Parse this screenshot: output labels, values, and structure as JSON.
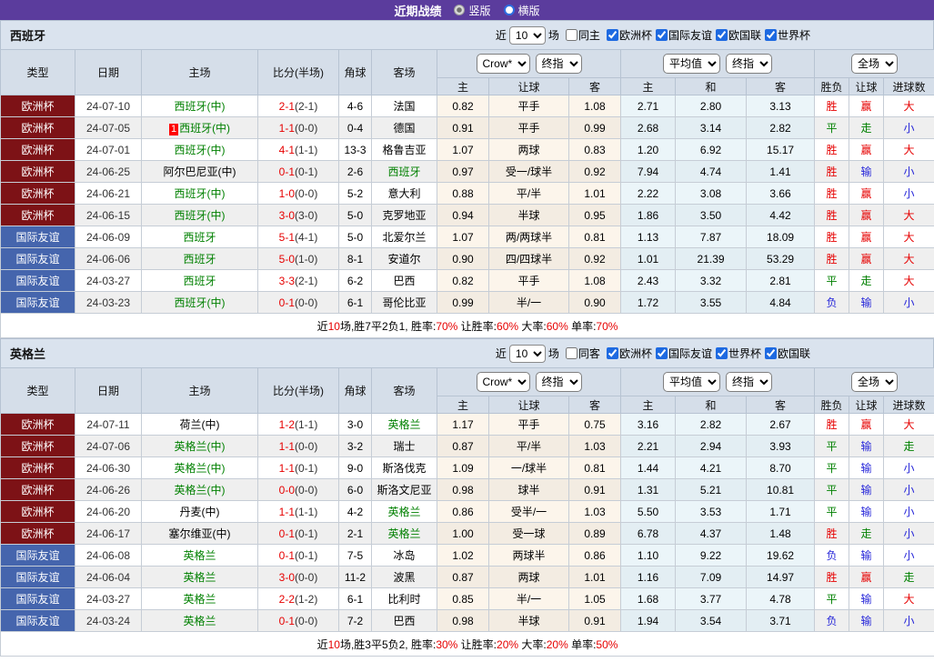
{
  "topbar": {
    "title": "近期战绩",
    "vertical_option": "竖版",
    "horizontal_option": "横版",
    "selected": "竖版"
  },
  "columns": {
    "main": [
      "类型",
      "日期",
      "主场",
      "比分(半场)",
      "角球",
      "客场"
    ],
    "sub": [
      "主",
      "让球",
      "客",
      "主",
      "和",
      "客",
      "胜负",
      "让球",
      "进球数"
    ],
    "selects": {
      "crow": "Crow*",
      "final1": "终指",
      "avg": "平均值",
      "final2": "终指",
      "scope": "全场"
    }
  },
  "result_color_class": {
    "胜": "red",
    "平": "green",
    "负": "blue",
    "赢": "red",
    "走": "green",
    "输": "blue",
    "大": "red",
    "小": "blue"
  },
  "colors": {
    "topbar": "#5b3c9d",
    "cup_league_bg": "#7d1216",
    "friendly_league_bg": "#4565ad",
    "team_highlight": "#008000",
    "score_red": "#e60000",
    "result_red": "#e60000",
    "result_green": "#008000",
    "result_blue": "#2626d9",
    "header_bg": "#d5dee9",
    "row_alt_bg": "#efefef",
    "crow_col_bg": "#fcf5eb",
    "avg_col_bg": "#ebf5f9"
  },
  "sections": [
    {
      "team": "西班牙",
      "filters": {
        "prefix": "近",
        "count": "10",
        "suffix": "场",
        "same": {
          "label": "同主",
          "checked": false
        },
        "leagues": [
          {
            "label": "欧洲杯",
            "checked": true
          },
          {
            "label": "国际友谊",
            "checked": true
          },
          {
            "label": "欧国联",
            "checked": true
          },
          {
            "label": "世界杯",
            "checked": true
          }
        ]
      },
      "rows": [
        {
          "league": "欧洲杯",
          "league_type": "cup",
          "date": "24-07-10",
          "home": "西班牙(中)",
          "home_hl": true,
          "home_badge": "",
          "score": "2-1",
          "half": "(2-1)",
          "corner": "4-6",
          "away": "法国",
          "away_hl": false,
          "crow": [
            "0.82",
            "平手",
            "1.08"
          ],
          "avg": [
            "2.71",
            "2.80",
            "3.13"
          ],
          "results": [
            "胜",
            "赢",
            "大"
          ]
        },
        {
          "league": "欧洲杯",
          "league_type": "cup",
          "date": "24-07-05",
          "home": "西班牙(中)",
          "home_hl": true,
          "home_badge": "1",
          "score": "1-1",
          "half": "(0-0)",
          "corner": "0-4",
          "away": "德国",
          "away_hl": false,
          "crow": [
            "0.91",
            "平手",
            "0.99"
          ],
          "avg": [
            "2.68",
            "3.14",
            "2.82"
          ],
          "results": [
            "平",
            "走",
            "小"
          ]
        },
        {
          "league": "欧洲杯",
          "league_type": "cup",
          "date": "24-07-01",
          "home": "西班牙(中)",
          "home_hl": true,
          "home_badge": "",
          "score": "4-1",
          "half": "(1-1)",
          "corner": "13-3",
          "away": "格鲁吉亚",
          "away_hl": false,
          "crow": [
            "1.07",
            "两球",
            "0.83"
          ],
          "avg": [
            "1.20",
            "6.92",
            "15.17"
          ],
          "results": [
            "胜",
            "赢",
            "大"
          ]
        },
        {
          "league": "欧洲杯",
          "league_type": "cup",
          "date": "24-06-25",
          "home": "阿尔巴尼亚(中)",
          "home_hl": false,
          "home_badge": "",
          "score": "0-1",
          "half": "(0-1)",
          "corner": "2-6",
          "away": "西班牙",
          "away_hl": true,
          "crow": [
            "0.97",
            "受一/球半",
            "0.92"
          ],
          "avg": [
            "7.94",
            "4.74",
            "1.41"
          ],
          "results": [
            "胜",
            "输",
            "小"
          ]
        },
        {
          "league": "欧洲杯",
          "league_type": "cup",
          "date": "24-06-21",
          "home": "西班牙(中)",
          "home_hl": true,
          "home_badge": "",
          "score": "1-0",
          "half": "(0-0)",
          "corner": "5-2",
          "away": "意大利",
          "away_hl": false,
          "crow": [
            "0.88",
            "平/半",
            "1.01"
          ],
          "avg": [
            "2.22",
            "3.08",
            "3.66"
          ],
          "results": [
            "胜",
            "赢",
            "小"
          ]
        },
        {
          "league": "欧洲杯",
          "league_type": "cup",
          "date": "24-06-15",
          "home": "西班牙(中)",
          "home_hl": true,
          "home_badge": "",
          "score": "3-0",
          "half": "(3-0)",
          "corner": "5-0",
          "away": "克罗地亚",
          "away_hl": false,
          "crow": [
            "0.94",
            "半球",
            "0.95"
          ],
          "avg": [
            "1.86",
            "3.50",
            "4.42"
          ],
          "results": [
            "胜",
            "赢",
            "大"
          ]
        },
        {
          "league": "国际友谊",
          "league_type": "friendly",
          "date": "24-06-09",
          "home": "西班牙",
          "home_hl": true,
          "home_badge": "",
          "score": "5-1",
          "half": "(4-1)",
          "corner": "5-0",
          "away": "北爱尔兰",
          "away_hl": false,
          "crow": [
            "1.07",
            "两/两球半",
            "0.81"
          ],
          "avg": [
            "1.13",
            "7.87",
            "18.09"
          ],
          "results": [
            "胜",
            "赢",
            "大"
          ]
        },
        {
          "league": "国际友谊",
          "league_type": "friendly",
          "date": "24-06-06",
          "home": "西班牙",
          "home_hl": true,
          "home_badge": "",
          "score": "5-0",
          "half": "(1-0)",
          "corner": "8-1",
          "away": "安道尔",
          "away_hl": false,
          "crow": [
            "0.90",
            "四/四球半",
            "0.92"
          ],
          "avg": [
            "1.01",
            "21.39",
            "53.29"
          ],
          "results": [
            "胜",
            "赢",
            "大"
          ]
        },
        {
          "league": "国际友谊",
          "league_type": "friendly",
          "date": "24-03-27",
          "home": "西班牙",
          "home_hl": true,
          "home_badge": "",
          "score": "3-3",
          "half": "(2-1)",
          "corner": "6-2",
          "away": "巴西",
          "away_hl": false,
          "crow": [
            "0.82",
            "平手",
            "1.08"
          ],
          "avg": [
            "2.43",
            "3.32",
            "2.81"
          ],
          "results": [
            "平",
            "走",
            "大"
          ]
        },
        {
          "league": "国际友谊",
          "league_type": "friendly",
          "date": "24-03-23",
          "home": "西班牙(中)",
          "home_hl": true,
          "home_badge": "",
          "score": "0-1",
          "half": "(0-0)",
          "corner": "6-1",
          "away": "哥伦比亚",
          "away_hl": false,
          "crow": [
            "0.99",
            "半/一",
            "0.90"
          ],
          "avg": [
            "1.72",
            "3.55",
            "4.84"
          ],
          "results": [
            "负",
            "输",
            "小"
          ]
        }
      ],
      "summary": [
        {
          "text": "近",
          "red": false
        },
        {
          "text": "10",
          "red": true
        },
        {
          "text": "场,胜7平2负1, 胜率:",
          "red": false
        },
        {
          "text": "70%",
          "red": true
        },
        {
          "text": " 让胜率:",
          "red": false
        },
        {
          "text": "60%",
          "red": true
        },
        {
          "text": " 大率:",
          "red": false
        },
        {
          "text": "60%",
          "red": true
        },
        {
          "text": " 单率:",
          "red": false
        },
        {
          "text": "70%",
          "red": true
        }
      ]
    },
    {
      "team": "英格兰",
      "filters": {
        "prefix": "近",
        "count": "10",
        "suffix": "场",
        "same": {
          "label": "同客",
          "checked": false
        },
        "leagues": [
          {
            "label": "欧洲杯",
            "checked": true
          },
          {
            "label": "国际友谊",
            "checked": true
          },
          {
            "label": "世界杯",
            "checked": true
          },
          {
            "label": "欧国联",
            "checked": true
          }
        ]
      },
      "rows": [
        {
          "league": "欧洲杯",
          "league_type": "cup",
          "date": "24-07-11",
          "home": "荷兰(中)",
          "home_hl": false,
          "home_badge": "",
          "score": "1-2",
          "half": "(1-1)",
          "corner": "3-0",
          "away": "英格兰",
          "away_hl": true,
          "crow": [
            "1.17",
            "平手",
            "0.75"
          ],
          "avg": [
            "3.16",
            "2.82",
            "2.67"
          ],
          "results": [
            "胜",
            "赢",
            "大"
          ]
        },
        {
          "league": "欧洲杯",
          "league_type": "cup",
          "date": "24-07-06",
          "home": "英格兰(中)",
          "home_hl": true,
          "home_badge": "",
          "score": "1-1",
          "half": "(0-0)",
          "corner": "3-2",
          "away": "瑞士",
          "away_hl": false,
          "crow": [
            "0.87",
            "平/半",
            "1.03"
          ],
          "avg": [
            "2.21",
            "2.94",
            "3.93"
          ],
          "results": [
            "平",
            "输",
            "走"
          ]
        },
        {
          "league": "欧洲杯",
          "league_type": "cup",
          "date": "24-06-30",
          "home": "英格兰(中)",
          "home_hl": true,
          "home_badge": "",
          "score": "1-1",
          "half": "(0-1)",
          "corner": "9-0",
          "away": "斯洛伐克",
          "away_hl": false,
          "crow": [
            "1.09",
            "一/球半",
            "0.81"
          ],
          "avg": [
            "1.44",
            "4.21",
            "8.70"
          ],
          "results": [
            "平",
            "输",
            "小"
          ]
        },
        {
          "league": "欧洲杯",
          "league_type": "cup",
          "date": "24-06-26",
          "home": "英格兰(中)",
          "home_hl": true,
          "home_badge": "",
          "score": "0-0",
          "half": "(0-0)",
          "corner": "6-0",
          "away": "斯洛文尼亚",
          "away_hl": false,
          "crow": [
            "0.98",
            "球半",
            "0.91"
          ],
          "avg": [
            "1.31",
            "5.21",
            "10.81"
          ],
          "results": [
            "平",
            "输",
            "小"
          ]
        },
        {
          "league": "欧洲杯",
          "league_type": "cup",
          "date": "24-06-20",
          "home": "丹麦(中)",
          "home_hl": false,
          "home_badge": "",
          "score": "1-1",
          "half": "(1-1)",
          "corner": "4-2",
          "away": "英格兰",
          "away_hl": true,
          "crow": [
            "0.86",
            "受半/一",
            "1.03"
          ],
          "avg": [
            "5.50",
            "3.53",
            "1.71"
          ],
          "results": [
            "平",
            "输",
            "小"
          ]
        },
        {
          "league": "欧洲杯",
          "league_type": "cup",
          "date": "24-06-17",
          "home": "塞尔维亚(中)",
          "home_hl": false,
          "home_badge": "",
          "score": "0-1",
          "half": "(0-1)",
          "corner": "2-1",
          "away": "英格兰",
          "away_hl": true,
          "crow": [
            "1.00",
            "受一球",
            "0.89"
          ],
          "avg": [
            "6.78",
            "4.37",
            "1.48"
          ],
          "results": [
            "胜",
            "走",
            "小"
          ]
        },
        {
          "league": "国际友谊",
          "league_type": "friendly",
          "date": "24-06-08",
          "home": "英格兰",
          "home_hl": true,
          "home_badge": "",
          "score": "0-1",
          "half": "(0-1)",
          "corner": "7-5",
          "away": "冰岛",
          "away_hl": false,
          "crow": [
            "1.02",
            "两球半",
            "0.86"
          ],
          "avg": [
            "1.10",
            "9.22",
            "19.62"
          ],
          "results": [
            "负",
            "输",
            "小"
          ]
        },
        {
          "league": "国际友谊",
          "league_type": "friendly",
          "date": "24-06-04",
          "home": "英格兰",
          "home_hl": true,
          "home_badge": "",
          "score": "3-0",
          "half": "(0-0)",
          "corner": "11-2",
          "away": "波黑",
          "away_hl": false,
          "crow": [
            "0.87",
            "两球",
            "1.01"
          ],
          "avg": [
            "1.16",
            "7.09",
            "14.97"
          ],
          "results": [
            "胜",
            "赢",
            "走"
          ]
        },
        {
          "league": "国际友谊",
          "league_type": "friendly",
          "date": "24-03-27",
          "home": "英格兰",
          "home_hl": true,
          "home_badge": "",
          "score": "2-2",
          "half": "(1-2)",
          "corner": "6-1",
          "away": "比利时",
          "away_hl": false,
          "crow": [
            "0.85",
            "半/一",
            "1.05"
          ],
          "avg": [
            "1.68",
            "3.77",
            "4.78"
          ],
          "results": [
            "平",
            "输",
            "大"
          ]
        },
        {
          "league": "国际友谊",
          "league_type": "friendly",
          "date": "24-03-24",
          "home": "英格兰",
          "home_hl": true,
          "home_badge": "",
          "score": "0-1",
          "half": "(0-0)",
          "corner": "7-2",
          "away": "巴西",
          "away_hl": false,
          "crow": [
            "0.98",
            "半球",
            "0.91"
          ],
          "avg": [
            "1.94",
            "3.54",
            "3.71"
          ],
          "results": [
            "负",
            "输",
            "小"
          ]
        }
      ],
      "summary": [
        {
          "text": "近",
          "red": false
        },
        {
          "text": "10",
          "red": true
        },
        {
          "text": "场,胜3平5负2, 胜率:",
          "red": false
        },
        {
          "text": "30%",
          "red": true
        },
        {
          "text": " 让胜率:",
          "red": false
        },
        {
          "text": "20%",
          "red": true
        },
        {
          "text": " 大率:",
          "red": false
        },
        {
          "text": "20%",
          "red": true
        },
        {
          "text": " 单率:",
          "red": false
        },
        {
          "text": "50%",
          "red": true
        }
      ]
    }
  ]
}
